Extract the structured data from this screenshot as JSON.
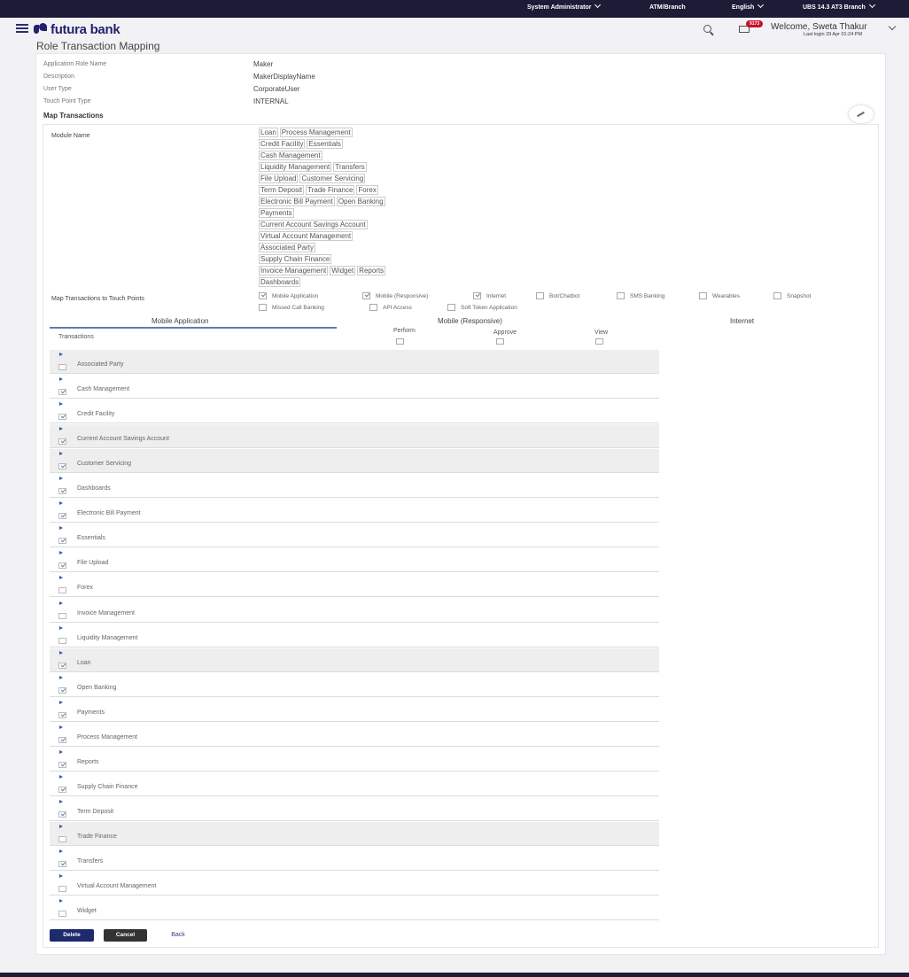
{
  "topbar": {
    "role": "System Administrator",
    "branch_menu": "ATM/Branch",
    "language": "English",
    "entity": "UBS 14.3 AT3 Branch"
  },
  "header": {
    "brand": "futura bank",
    "mail_badge": "9173",
    "welcome": "Welcome, Sweta Thakur",
    "last_login": "Last login 29 Apr 01:24 PM"
  },
  "page_title": "Role Transaction Mapping",
  "details": [
    {
      "label": "Application Role Name",
      "value": "Maker"
    },
    {
      "label": "Description",
      "value": "MakerDisplayName"
    },
    {
      "label": "User Type",
      "value": "CorporateUser"
    },
    {
      "label": "Touch Point Type",
      "value": "INTERNAL"
    }
  ],
  "map_section": {
    "title": "Map Transactions",
    "module_label": "Module Name",
    "modules": [
      [
        "Loan",
        "Process Management"
      ],
      [
        "Credit Facility",
        "Essentials"
      ],
      [
        "Cash Management"
      ],
      [
        "Liquidity Management",
        "Transfers"
      ],
      [
        "File Upload",
        "Customer Servicing"
      ],
      [
        "Term Deposit",
        "Trade Finance",
        "Forex"
      ],
      [
        "Electronic Bill Payment",
        "Open Banking"
      ],
      [
        "Payments"
      ],
      [
        "Current Account Savings Account"
      ],
      [
        "Virtual Account Management"
      ],
      [
        "Associated Party"
      ],
      [
        "Supply Chain Finance"
      ],
      [
        "Invoice Management",
        "Widget",
        "Reports"
      ],
      [
        "Dashboards"
      ]
    ],
    "touch_points_label": "Map Transactions to Touch Points",
    "touch_points": [
      {
        "label": "Mobile Application",
        "checked": true
      },
      {
        "label": "Mobile (Responsive)",
        "checked": true
      },
      {
        "label": "Internet",
        "checked": true
      },
      {
        "label": "Bot/Chatbot",
        "checked": false
      },
      {
        "label": "SMS Banking",
        "checked": false
      },
      {
        "label": "Wearables",
        "checked": false
      },
      {
        "label": "Snapshot",
        "checked": false
      },
      {
        "label": "Missed Call Banking",
        "checked": false
      },
      {
        "label": "API Access",
        "checked": false
      },
      {
        "label": "Soft Token Application",
        "checked": false
      }
    ]
  },
  "tabs": [
    "Mobile Application",
    "Mobile (Responsive)",
    "Internet"
  ],
  "table": {
    "transactions_header": "Transactions",
    "columns": [
      "Perform",
      "Approve",
      "View"
    ],
    "rows": [
      {
        "label": "Associated Party",
        "checked": false,
        "shaded": true
      },
      {
        "label": "Cash Management",
        "checked": true,
        "shaded": false
      },
      {
        "label": "Credit Facility",
        "checked": true,
        "shaded": false
      },
      {
        "label": "Current Account Savings Account",
        "checked": true,
        "shaded": true
      },
      {
        "label": "Customer Servicing",
        "checked": true,
        "shaded": true
      },
      {
        "label": "Dashboards",
        "checked": true,
        "shaded": false
      },
      {
        "label": "Electronic Bill Payment",
        "checked": true,
        "shaded": false
      },
      {
        "label": "Essentials",
        "checked": true,
        "shaded": false
      },
      {
        "label": "File Upload",
        "checked": true,
        "shaded": false
      },
      {
        "label": "Forex",
        "checked": false,
        "shaded": false
      },
      {
        "label": "Invoice Management",
        "checked": false,
        "shaded": false
      },
      {
        "label": "Liquidity Management",
        "checked": false,
        "shaded": false
      },
      {
        "label": "Loan",
        "checked": true,
        "shaded": true
      },
      {
        "label": "Open Banking",
        "checked": true,
        "shaded": false
      },
      {
        "label": "Payments",
        "checked": true,
        "shaded": false
      },
      {
        "label": "Process Management",
        "checked": true,
        "shaded": false
      },
      {
        "label": "Reports",
        "checked": true,
        "shaded": false
      },
      {
        "label": "Supply Chain Finance",
        "checked": true,
        "shaded": false
      },
      {
        "label": "Term Deposit",
        "checked": true,
        "shaded": false
      },
      {
        "label": "Trade Finance",
        "checked": false,
        "shaded": true
      },
      {
        "label": "Transfers",
        "checked": true,
        "shaded": false
      },
      {
        "label": "Virtual Account Management",
        "checked": false,
        "shaded": false
      },
      {
        "label": "Widget",
        "checked": false,
        "shaded": false
      }
    ]
  },
  "buttons": {
    "delete": "Delete",
    "cancel": "Cancel",
    "back": "Back"
  },
  "colors": {
    "topbar": "#1d1b36",
    "brand": "#23206f",
    "primary_button": "#1d2a6b",
    "tab_active": "#5b7db3",
    "badge": "#c8102e"
  }
}
